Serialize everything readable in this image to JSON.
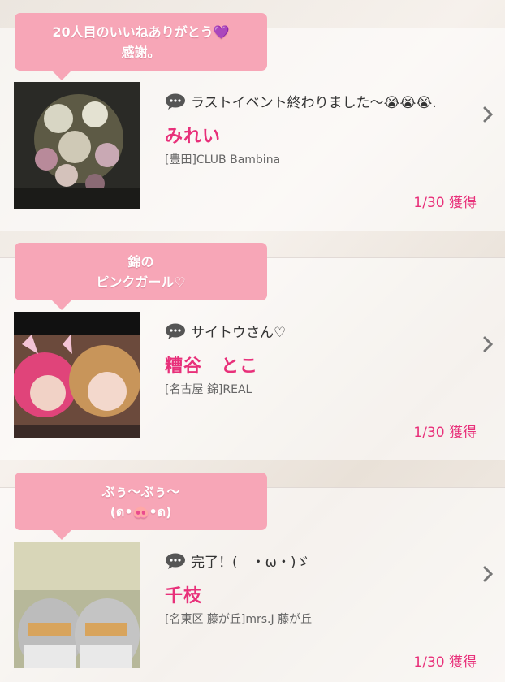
{
  "accent_color": "#e8307a",
  "bubble_color": "#f7a6b7",
  "cards": [
    {
      "bubble_line1": "20人目のいいねありがとう💜",
      "bubble_line2": "感謝。",
      "comment": "ラストイベント終わりました〜😭😭😭.",
      "name": "みれい",
      "shop": "[豊田]CLUB Bambina",
      "count": "1/30 獲得"
    },
    {
      "bubble_line1": "錦の",
      "bubble_line2": "ピンクガール♡",
      "comment": "サイトウさん♡",
      "name": "糟谷　とこ",
      "shop": "[名古屋 錦]REAL",
      "count": "1/30 獲得"
    },
    {
      "bubble_line1": "ぶぅ〜ぶぅ〜",
      "bubble_line2": "(ด•🐽•ด)",
      "comment": "完了！(　・ω・)ゞ",
      "name": "千枝",
      "shop": "[名東区 藤が丘]mrs.J 藤が丘",
      "count": "1/30 獲得"
    }
  ]
}
